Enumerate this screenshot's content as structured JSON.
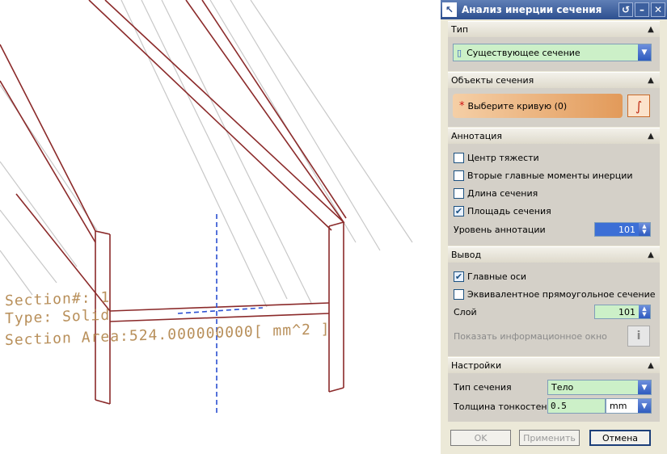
{
  "viewport": {
    "annotation_lines": [
      "Section#: 1",
      "Type: Solid",
      "Section Area:524.000000000[ mm^2 ]"
    ]
  },
  "dialog": {
    "title": "Анализ инерции сечения",
    "title_icon": "arrow-icon",
    "sections": {
      "type": {
        "label": "Тип",
        "dropdown_value": "Существующее сечение"
      },
      "objects": {
        "label": "Объекты сечения",
        "select_prompt": "Выберите кривую (0)",
        "required_marker": "*"
      },
      "annotation": {
        "label": "Аннотация",
        "options": [
          {
            "label": "Центр тяжести",
            "checked": false
          },
          {
            "label": "Вторые главные моменты инерции",
            "checked": false
          },
          {
            "label": "Длина сечения",
            "checked": false
          },
          {
            "label": "Площадь сечения",
            "checked": true
          }
        ],
        "level_label": "Уровень аннотации",
        "level_value": "101"
      },
      "output": {
        "label": "Вывод",
        "options": [
          {
            "label": "Главные оси",
            "checked": true
          },
          {
            "label": "Эквивалентное прямоугольное сечение",
            "checked": false
          }
        ],
        "layer_label": "Слой",
        "layer_value": "101",
        "info_label": "Показать информационное окно"
      },
      "settings": {
        "label": "Настройки",
        "section_type_label": "Тип сечения",
        "section_type_value": "Тело",
        "thickness_label": "Толщина тонкостенног",
        "thickness_value": "0.5",
        "thickness_unit": "mm"
      }
    },
    "buttons": {
      "ok": "OK",
      "apply": "Применить",
      "cancel": "Отмена"
    }
  }
}
